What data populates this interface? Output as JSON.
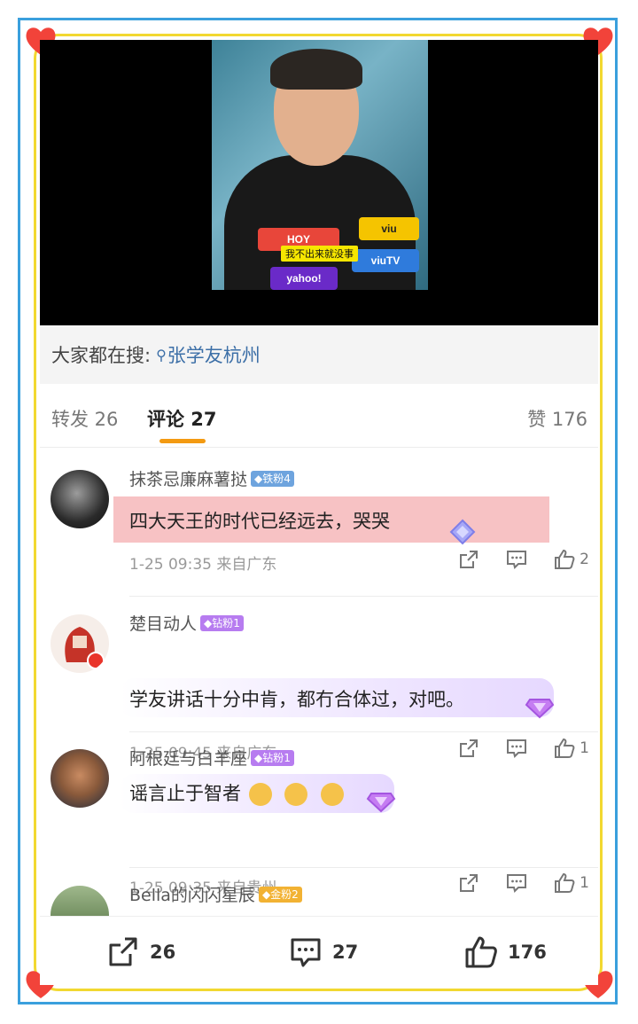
{
  "search": {
    "label": "大家都在搜:",
    "query": "张学友杭州"
  },
  "video": {
    "caption": "我不出来就没事",
    "mics": [
      "HOY",
      "viu",
      "viuTV",
      "yahoo!"
    ]
  },
  "tabs": [
    {
      "label": "转发 26"
    },
    {
      "label": "评论 27"
    },
    {
      "label": "赞 176"
    }
  ],
  "comments": [
    {
      "user": "抹茶忌廉麻薯挞",
      "badge": "铁粉4",
      "text": "四大天王的时代已经远去，哭哭",
      "meta": "1-25 09:35 来自广东",
      "likes": "2"
    },
    {
      "user": "楚目动人",
      "badge": "钻粉1",
      "text": "学友讲话十分中肯，都冇合体过，对吧。",
      "meta": "1-25 09:45 来自广东",
      "likes": "1"
    },
    {
      "user": "阿根廷与白羊座",
      "badge": "钻粉1",
      "text": "谣言止于智者",
      "meta": "1-25 09:35 来自贵州",
      "likes": "1"
    },
    {
      "user": "Bella的闪闪星辰",
      "badge": "金粉2"
    }
  ],
  "bottom": {
    "reposts": "26",
    "comments": "27",
    "likes": "176"
  },
  "colors": {
    "outer_frame": "#3aa0dd",
    "inner_frame": "#f2d830",
    "heart": "#f2433a",
    "accent_tab": "#f39a12",
    "link": "#3c6fa7",
    "highlight": "#f7c2c4"
  }
}
